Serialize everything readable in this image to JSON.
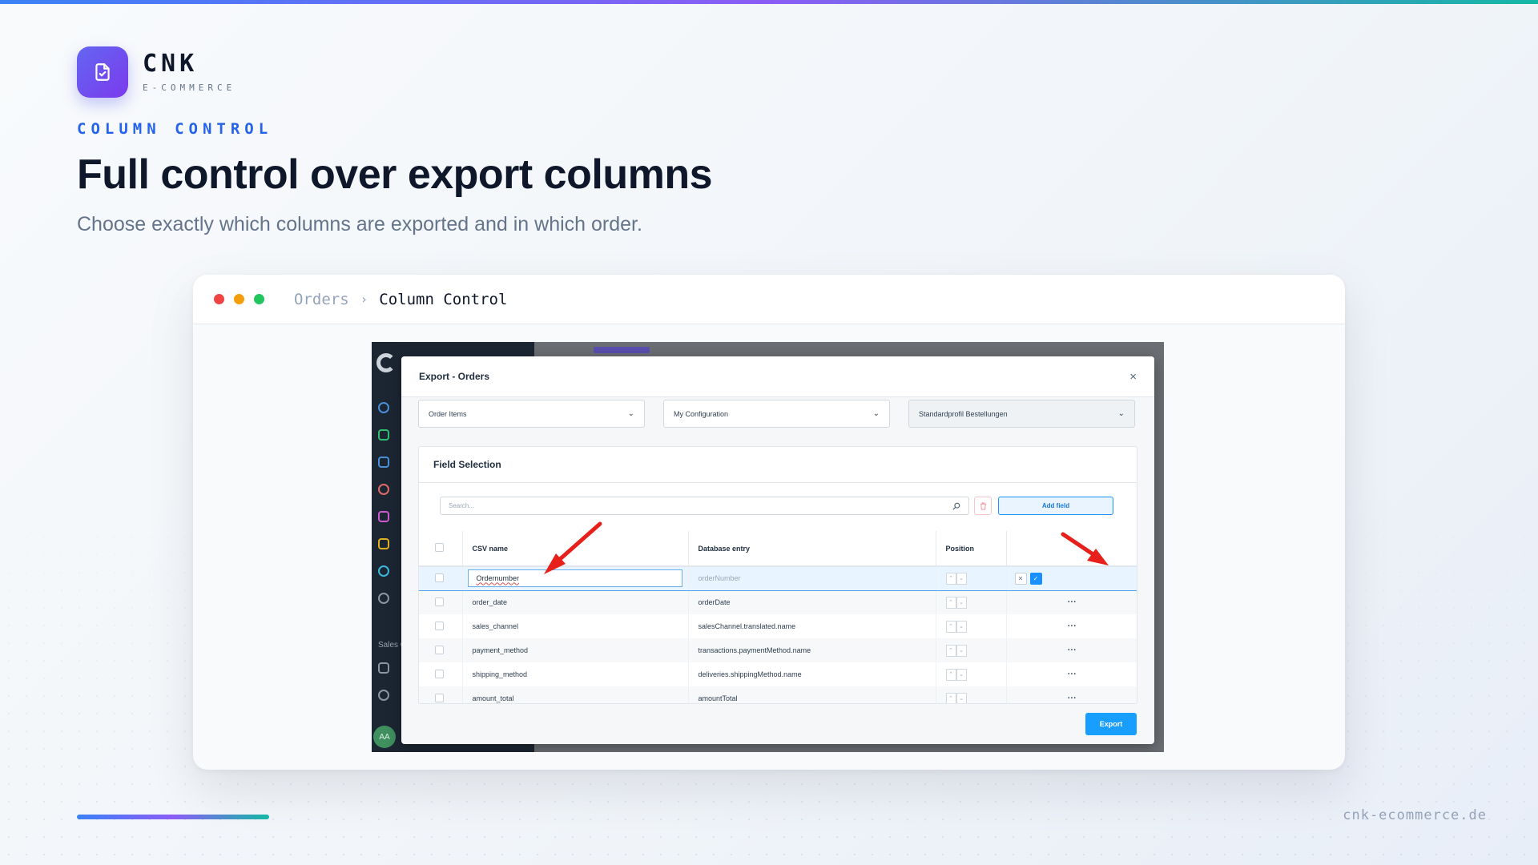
{
  "brand": {
    "name": "CNK",
    "sub": "E-COMMERCE"
  },
  "eyebrow": "COLUMN CONTROL",
  "headline": "Full control over export columns",
  "subline": "Choose exactly which columns are exported and in which order.",
  "window": {
    "breadcrumb": [
      "Orders",
      "Column Control"
    ],
    "separator": "›"
  },
  "shot": {
    "sidebar_label": "Sales C",
    "avatar": "AA",
    "modal": {
      "title": "Export - Orders",
      "close": "×",
      "selects": [
        "Order Items",
        "My Configuration",
        "Standardprofil Bestellungen"
      ],
      "card_title": "Field Selection",
      "search_placeholder": "Search...",
      "add_field_label": "Add field",
      "columns": [
        "CSV name",
        "Database entry",
        "Position"
      ],
      "editing_row": {
        "csv_name": "Ordernumber",
        "db_entry": "orderNumber"
      },
      "rows": [
        {
          "csv_name": "order_date",
          "db_entry": "orderDate"
        },
        {
          "csv_name": "sales_channel",
          "db_entry": "salesChannel.translated.name"
        },
        {
          "csv_name": "payment_method",
          "db_entry": "transactions.paymentMethod.name"
        },
        {
          "csv_name": "shipping_method",
          "db_entry": "deliveries.shippingMethod.name"
        },
        {
          "csv_name": "amount_total",
          "db_entry": "amountTotal"
        }
      ],
      "row_menu": "···",
      "export_label": "Export"
    }
  },
  "footer_url": "cnk-ecommerce.de",
  "colors": {
    "accent_blue": "#2563eb",
    "brand_purple": "#6366f1",
    "shopware_blue": "#189eff",
    "annotation_red": "#e8201b"
  },
  "icons": [
    "file-check-icon",
    "chevron-down-icon",
    "search-icon",
    "trash-icon",
    "close-icon",
    "check-icon",
    "arrow-annotation-icon"
  ]
}
